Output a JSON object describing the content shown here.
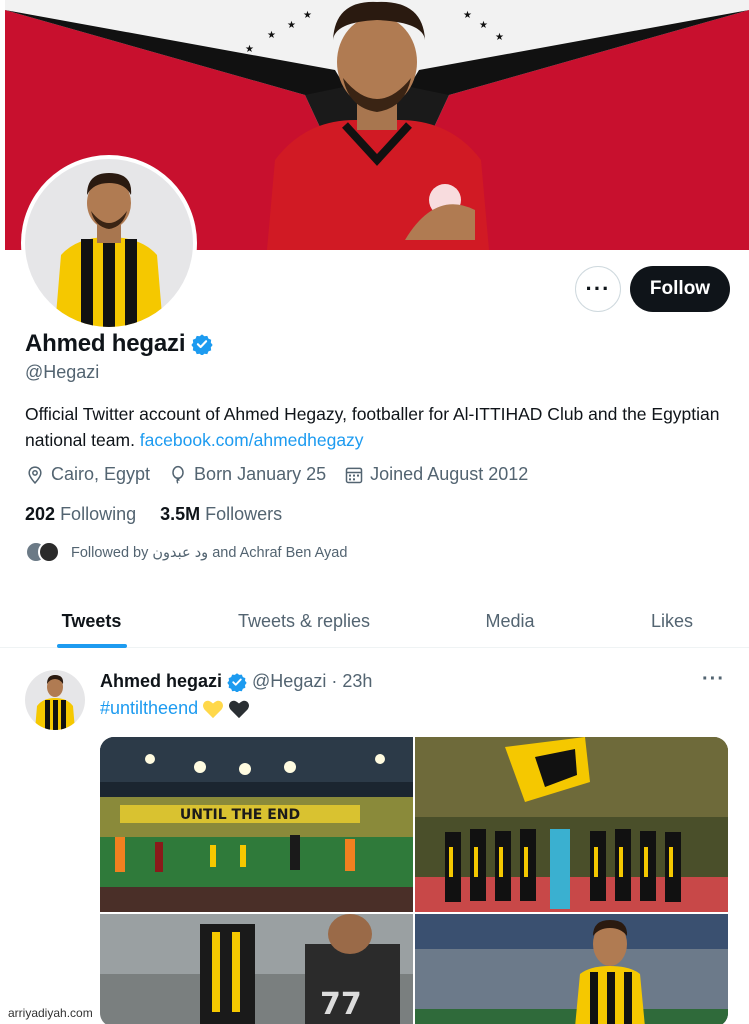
{
  "profile": {
    "display_name": "Ahmed hegazi",
    "handle": "@Hegazi",
    "bio_text": "Official Twitter account of Ahmed Hegazy, footballer for Al-ITTIHAD Club and the Egyptian national team. ",
    "bio_link": "facebook.com/ahmedhegazy",
    "location": "Cairo, Egypt",
    "birthday": "Born January 25",
    "joined": "Joined August 2012",
    "following_count": "202",
    "following_label": "Following",
    "followers_count": "3.5M",
    "followers_label": "Followers",
    "followed_by": "Followed by ود عبدون and Achraf Ben Ayad"
  },
  "actions": {
    "more_label": "···",
    "follow_label": "Follow"
  },
  "tabs": [
    {
      "label": "Tweets",
      "active": true
    },
    {
      "label": "Tweets & replies",
      "active": false
    },
    {
      "label": "Media",
      "active": false
    },
    {
      "label": "Likes",
      "active": false
    }
  ],
  "tweet": {
    "name": "Ahmed hegazi",
    "handle": "@Hegazi",
    "separator": "·",
    "time": "23h",
    "text": "#untiltheend",
    "emoji_icons": [
      "yellow-heart-icon",
      "black-heart-icon"
    ],
    "more_label": "···",
    "stadium_banner_text": "UNTIL THE END"
  },
  "icons": {
    "verified": "verified-badge-icon",
    "location": "location-pin-icon",
    "birthday": "balloon-icon",
    "joined": "calendar-icon"
  },
  "colors": {
    "accent": "#1d9bf0",
    "text_primary": "#0f1419",
    "text_secondary": "#536471",
    "follow_bg": "#0f1419",
    "ittihad_yellow": "#f5c800",
    "egypt_red": "#c8102e"
  },
  "watermark": "arriyadiyah.com"
}
